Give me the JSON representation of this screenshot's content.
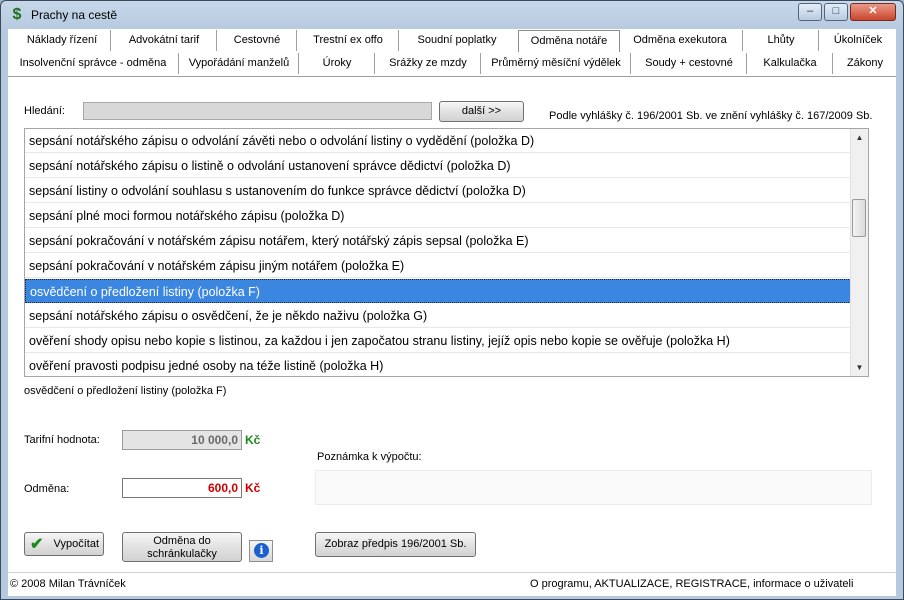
{
  "window": {
    "title": "Prachy na cestě",
    "app_icon": "$",
    "min_label": "–",
    "max_label": "□",
    "close_label": "✕"
  },
  "tabs_row1": [
    "Náklady řízení",
    "Advokátní tarif",
    "Cestovné",
    "Trestní ex offo",
    "Soudní poplatky",
    "Odměna notáře",
    "Odměna exekutora",
    "Lhůty",
    "Úkolníček"
  ],
  "tabs_row1_active": 5,
  "tabs_row2": [
    "Insolvenční správce - odměna",
    "Vypořádání manželů",
    "Úroky",
    "Srážky ze mzdy",
    "Průměrný měsíční výdělek",
    "Soudy + cestovné",
    "Kalkulačka",
    "Zákony"
  ],
  "search": {
    "label": "Hledání:",
    "value": "",
    "next_button": "další >>",
    "regulation_note": "Podle vyhlášky č. 196/2001 Sb. ve znění vyhlášky č. 167/2009 Sb."
  },
  "list": {
    "items": [
      "sepsání notářského zápisu o odvolání závěti nebo o odvolání listiny o vydědění (položka D)",
      "sepsání notářského zápisu o listině o odvolání ustanovení správce dědictví (položka D)",
      "sepsání listiny o odvolání souhlasu s ustanovením do funkce správce dědictví (položka D)",
      "sepsání plné moci formou notářského zápisu (položka D)",
      "sepsání pokračování v notářském zápisu notářem, který notářský zápis sepsal (položka E)",
      "sepsání pokračování v notářském zápisu jiným notářem (položka E)",
      "osvědčení o předložení listiny (položka F)",
      "sepsání notářského zápisu o osvědčení, že je někdo naživu (položka G)",
      "ověření shody opisu nebo kopie s listinou, za každou i jen započatou stranu listiny, jejíž opis nebo kopie se ověřuje (položka H)",
      "ověření pravosti podpisu jedné osoby na téže listině (položka H)"
    ],
    "selected_index": 6,
    "scroll_up_icon": "▲",
    "scroll_down_icon": "▼"
  },
  "selected_description": "osvědčení o předložení listiny (položka F)",
  "tariff": {
    "label": "Tarifní hodnota:",
    "value": "10 000,0",
    "currency": "Kč",
    "currency_color": "#1b8a1b"
  },
  "reward": {
    "label": "Odměna:",
    "value": "600,0",
    "currency": "Kč",
    "value_color": "#cc0000"
  },
  "note": {
    "label": "Poznámka k výpočtu:",
    "value": ""
  },
  "buttons": {
    "calculate": "Vypočítat",
    "to_clipboard": "Odměna do schránkulačky",
    "info_icon": "i",
    "show_regulation": "Zobraz předpis 196/2001 Sb."
  },
  "status": {
    "copyright": "© 2008 Milan Trávníček",
    "links": "O programu, AKTUALIZACE, REGISTRACE, informace o uživateli"
  }
}
